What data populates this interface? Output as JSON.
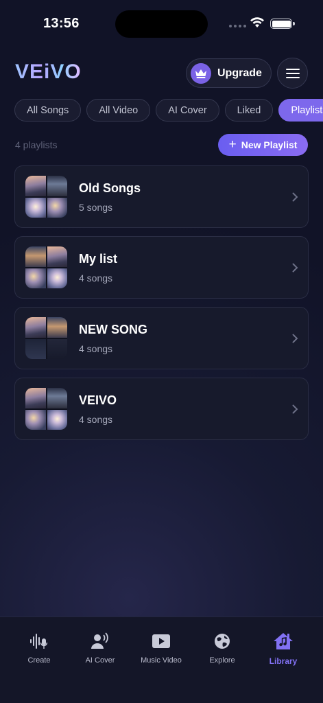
{
  "status_bar": {
    "time": "13:56"
  },
  "header": {
    "logo": "VEiVO",
    "upgrade_label": "Upgrade"
  },
  "filter_tabs": [
    {
      "label": "All Songs",
      "active": false
    },
    {
      "label": "All Video",
      "active": false
    },
    {
      "label": "AI Cover",
      "active": false
    },
    {
      "label": "Liked",
      "active": false
    },
    {
      "label": "Playlists",
      "active": true
    }
  ],
  "playlists_count": "4 playlists",
  "new_playlist_label": "New Playlist",
  "playlists": [
    {
      "title": "Old Songs",
      "subtitle": "5 songs"
    },
    {
      "title": "My list",
      "subtitle": "4 songs"
    },
    {
      "title": "NEW SONG",
      "subtitle": "4 songs"
    },
    {
      "title": "VEIVO",
      "subtitle": "4 songs"
    }
  ],
  "bottom_nav": [
    {
      "label": "Create",
      "icon": "waveform-mic-icon",
      "active": false
    },
    {
      "label": "AI Cover",
      "icon": "voice-person-icon",
      "active": false
    },
    {
      "label": "Music Video",
      "icon": "play-video-icon",
      "active": false
    },
    {
      "label": "Explore",
      "icon": "globe-icon",
      "active": false
    },
    {
      "label": "Library",
      "icon": "home-music-icon",
      "active": true
    }
  ],
  "colors": {
    "accent": "#7d68ec",
    "background": "#141628"
  }
}
